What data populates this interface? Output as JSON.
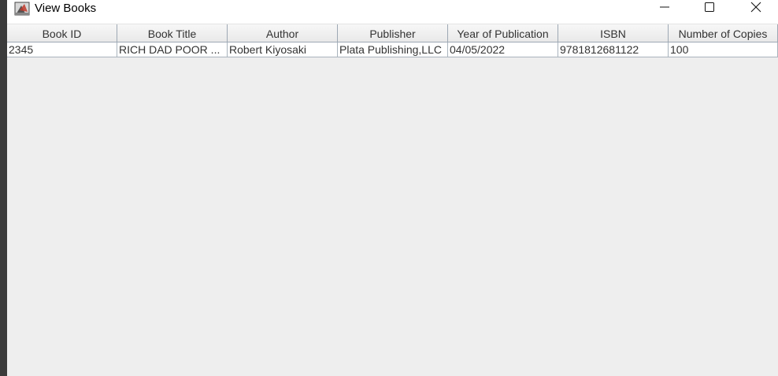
{
  "window": {
    "title": "View Books",
    "icon": "java-app-icon"
  },
  "controls": {
    "minimize_icon": "minimize-icon",
    "maximize_icon": "maximize-icon",
    "close_icon": "close-icon"
  },
  "table": {
    "columns": [
      "Book ID",
      "Book Title",
      "Author",
      "Publisher",
      "Year of Publication",
      "ISBN",
      "Number of Copies"
    ],
    "rows": [
      [
        "2345",
        "RICH DAD POOR ...",
        "Robert Kiyosaki",
        "Plata Publishing,LLC",
        "04/05/2022",
        "9781812681122",
        "100"
      ]
    ]
  }
}
